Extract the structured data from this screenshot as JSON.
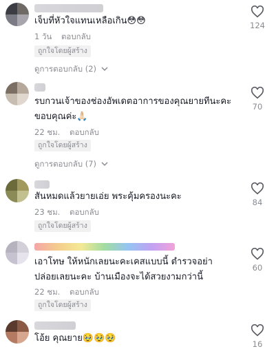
{
  "icons": {
    "like": "heart-outline-icon",
    "expand": "chevron-down-icon"
  },
  "colors": {
    "text": "#161823",
    "muted": "#8a8b91",
    "badge_bg": "#f1f1f2"
  },
  "comments": [
    {
      "text": "เจ็บที่หัวใจแทนเหลือเกิน😳😳",
      "time": "1 วัน",
      "reply_label": "ตอบกลับ",
      "badge": "ถูกใจโดยผู้สร้าง",
      "likes": "124",
      "view_replies": "ดูการตอบกลับ (2)"
    },
    {
      "text_line1": "รบกวนเจ้าของช่องอัพเดตอาการของคุณยายทีนะคะ",
      "text_line2": "ขอบคุณค่ะ🙏🏻",
      "time": "22 ชม.",
      "reply_label": "ตอบกลับ",
      "badge": "ถูกใจโดยผู้สร้าง",
      "likes": "70",
      "view_replies": "ดูการตอบกลับ (7)"
    },
    {
      "text": "สันหมดแล้วยายเอ่ย พระคุ้มครองนะคะ",
      "time": "23 ชม.",
      "reply_label": "ตอบกลับ",
      "badge": "ถูกใจโดยผู้สร้าง",
      "likes": "84"
    },
    {
      "text_line1": "เอาโทษ ให้หนักเลยนะคะเคสแบบนี้ ตำรวจอย่า",
      "text_line2": "ปล่อยเลยนะคะ บ้านเมืองจะได้สวยงามกว่านี้",
      "time": "22 ชม.",
      "reply_label": "ตอบกลับ",
      "badge": "ถูกใจโดยผู้สร้าง",
      "likes": "60"
    },
    {
      "text": "โอ้ย คุณยาย🥹🥹🥹",
      "likes": "16"
    }
  ]
}
